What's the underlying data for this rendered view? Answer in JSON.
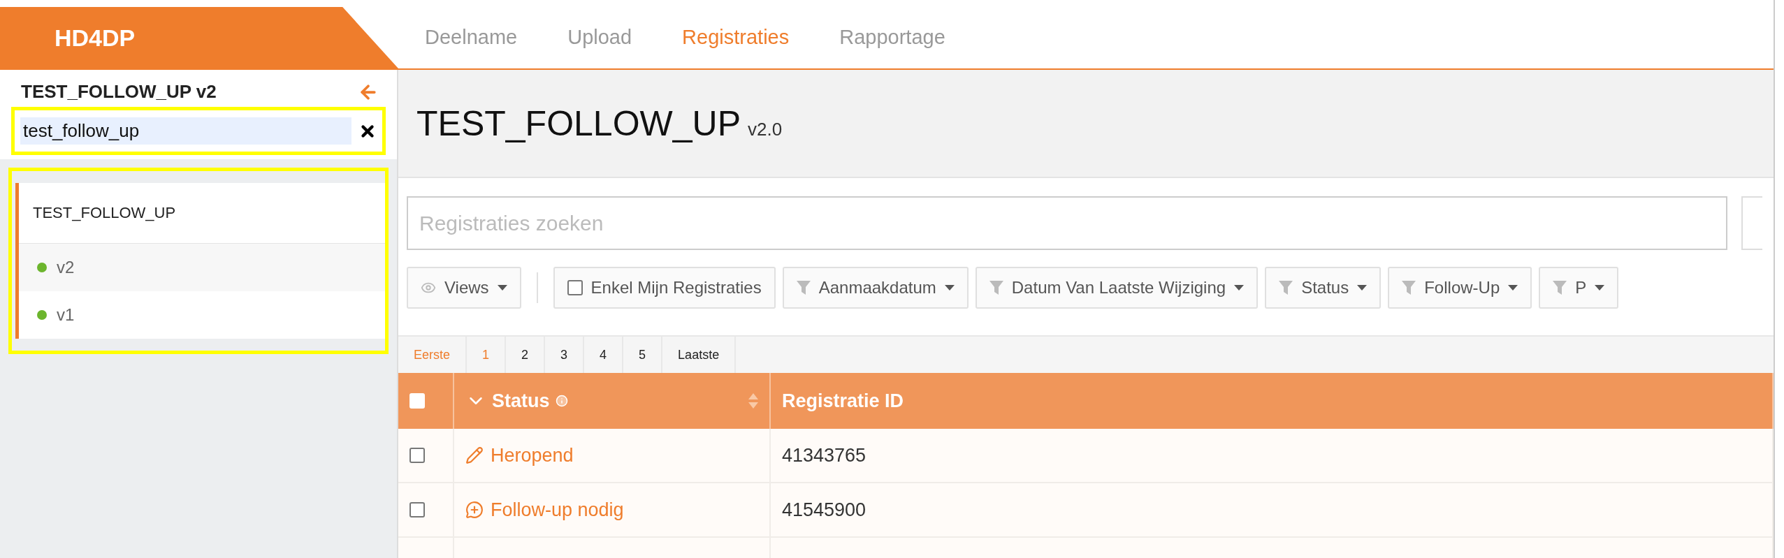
{
  "logo": "HD4DP",
  "nav": [
    {
      "label": "Deelname",
      "selected": false
    },
    {
      "label": "Upload",
      "selected": false
    },
    {
      "label": "Registraties",
      "selected": true
    },
    {
      "label": "Rapportage",
      "selected": false
    }
  ],
  "sidebar": {
    "title": "TEST_FOLLOW_UP v2",
    "search": {
      "value": "test_follow_up",
      "highlighted": true
    },
    "tree": {
      "highlighted": true,
      "items": [
        {
          "label": "TEST_FOLLOW_UP",
          "expanded": true,
          "children": [
            {
              "label": "v2",
              "color": "#6cb52d"
            },
            {
              "label": "v1",
              "color": "#6cb52d"
            }
          ]
        }
      ]
    }
  },
  "main": {
    "title": "TEST_FOLLOW_UP",
    "version": "v2.0",
    "search": {
      "placeholder": "Registraties zoeken"
    },
    "toolbar": [
      {
        "kind": "views",
        "label": "Views"
      },
      {
        "kind": "checkbox",
        "label": "Enkel Mijn Registraties",
        "checked": false
      },
      {
        "kind": "filter",
        "label": "Aanmaakdatum"
      },
      {
        "kind": "filter",
        "label": "Datum Van Laatste Wijziging"
      },
      {
        "kind": "filter",
        "label": "Status"
      },
      {
        "kind": "filter",
        "label": "Follow-Up"
      },
      {
        "kind": "filter",
        "label": "P"
      }
    ],
    "pagination": [
      {
        "label": "Eerste",
        "selected": true
      },
      {
        "label": "1",
        "selected": true
      },
      {
        "label": "2",
        "selected": false
      },
      {
        "label": "3",
        "selected": false
      },
      {
        "label": "4",
        "selected": false
      },
      {
        "label": "5",
        "selected": false
      },
      {
        "label": "Laatste",
        "selected": false
      }
    ],
    "table": {
      "header_checked": false,
      "columns": [
        {
          "label": "Status",
          "sortable": true,
          "info": true
        },
        {
          "label": "Registratie ID",
          "sortable": false,
          "info": false
        }
      ],
      "rows": [
        {
          "checked": false,
          "status": {
            "kind": "reopened",
            "label": "Heropend"
          },
          "id": "41343765"
        },
        {
          "checked": false,
          "status": {
            "kind": "follow-up",
            "label": "Follow-up nodig"
          },
          "id": "41545900"
        }
      ]
    }
  }
}
